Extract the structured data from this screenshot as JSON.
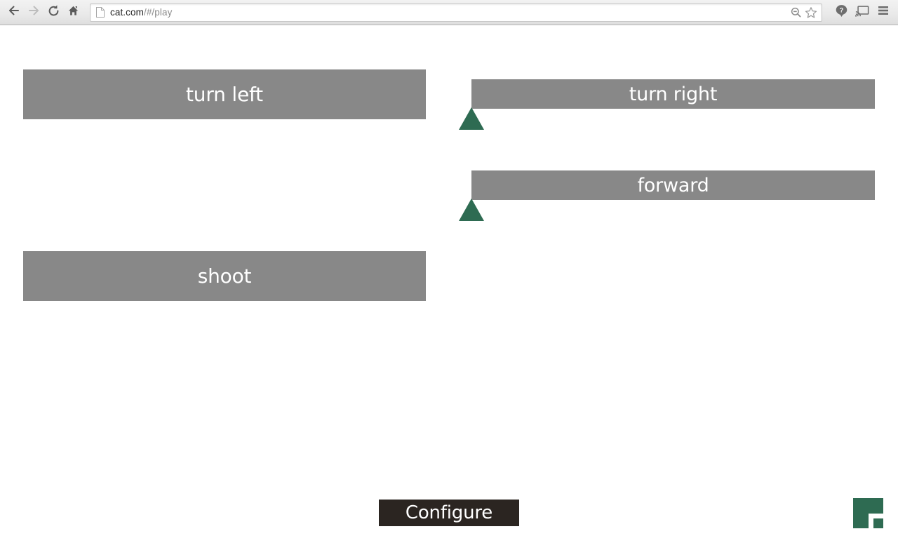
{
  "browser": {
    "back_icon": "back-arrow-icon",
    "forward_icon": "forward-arrow-icon",
    "reload_icon": "reload-icon",
    "home_icon": "home-icon",
    "page_icon": "page-document-icon",
    "url_host": "cat.com",
    "url_path": "/#/play",
    "url_full": "cat.com/#/play",
    "zoom_out_icon": "zoom-out-icon",
    "bookmark_icon": "star-bookmark-icon",
    "help_icon": "help-question-icon",
    "cast_icon": "cast-icon",
    "menu_icon": "hamburger-menu-icon"
  },
  "page": {
    "commands": [
      {
        "id": "turn-left",
        "label": "turn left",
        "column": "left",
        "has_marker": false
      },
      {
        "id": "shoot",
        "label": "shoot",
        "column": "left",
        "has_marker": false
      },
      {
        "id": "turn-right",
        "label": "turn right",
        "column": "right",
        "has_marker": true
      },
      {
        "id": "forward",
        "label": "forward",
        "column": "right",
        "has_marker": true
      }
    ],
    "configure_label": "Configure",
    "add_icon": "plus-icon"
  },
  "colors": {
    "command_button": "#888888",
    "command_text": "#ffffff",
    "marker_green": "#2e6b52",
    "configure_bg": "#2b2521",
    "add_button_bg": "#2e6b52",
    "page_bg": "#ffffff"
  }
}
